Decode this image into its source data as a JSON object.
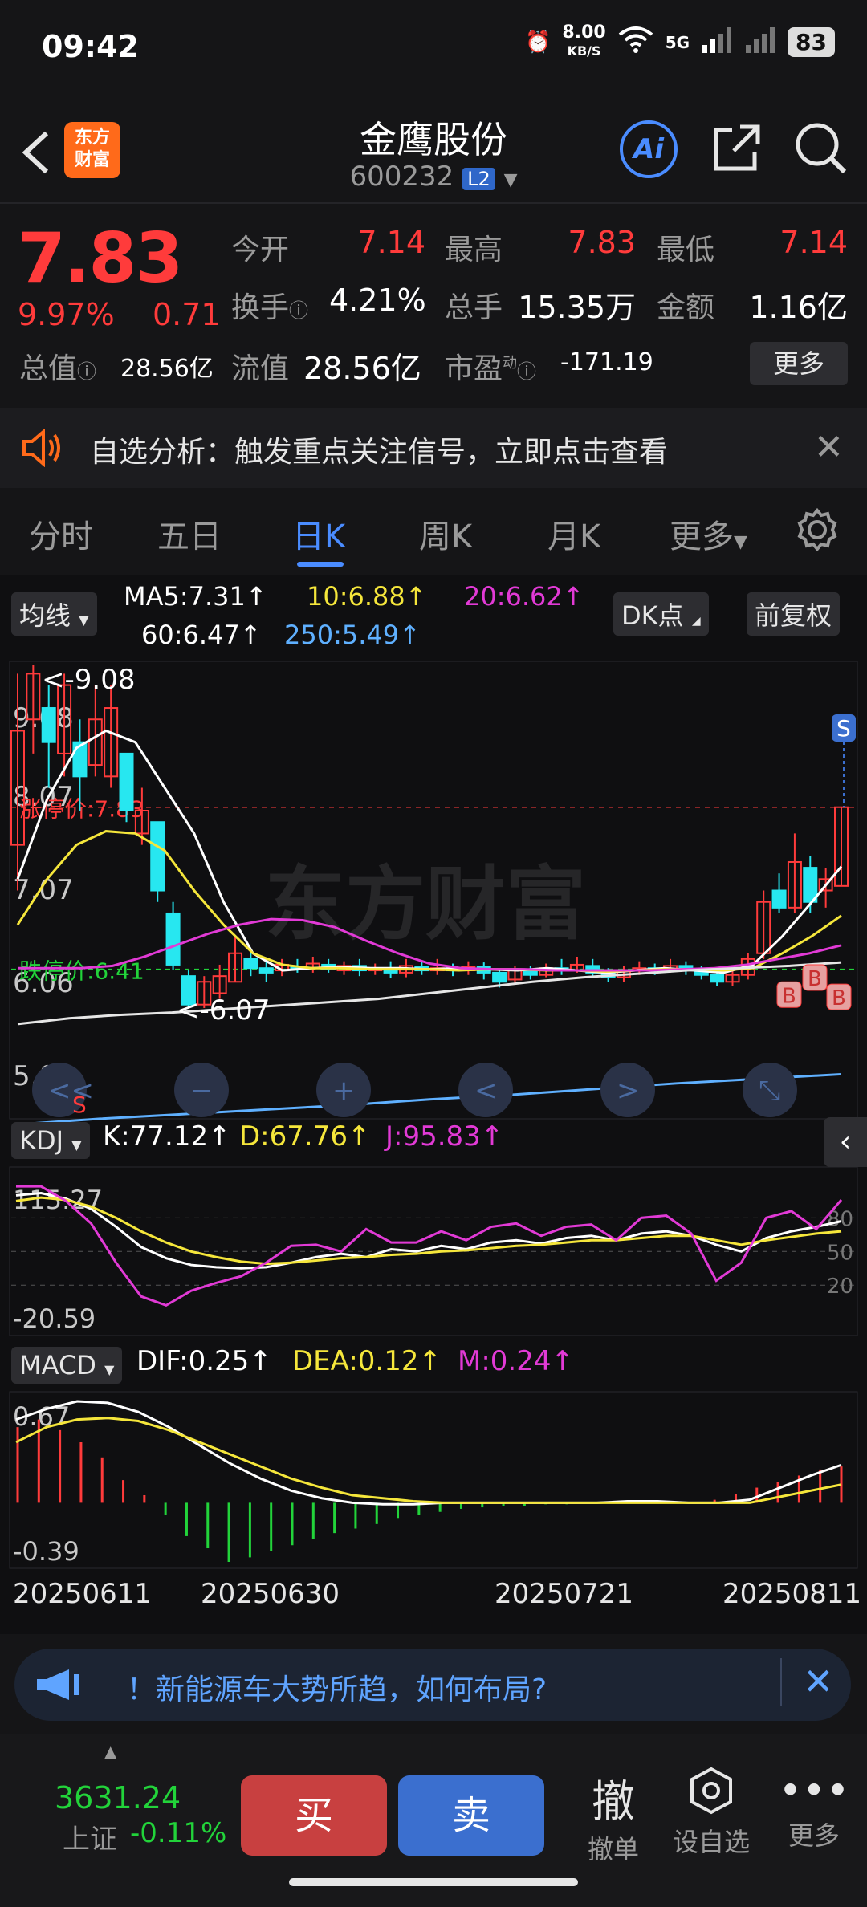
{
  "status_bar": {
    "time": "09:42",
    "net_speed_top": "8.00",
    "net_speed_unit": "KB/S",
    "signal": "5G",
    "battery": "83"
  },
  "header": {
    "logo_line1": "东方",
    "logo_line2": "财富",
    "stock_name": "金鹰股份",
    "stock_code": "600232",
    "level_badge": "L2"
  },
  "quote": {
    "price": "7.83",
    "change_pct": "9.97%",
    "change": "0.71",
    "open_label": "今开",
    "open": "7.14",
    "high_label": "最高",
    "high": "7.83",
    "low_label": "最低",
    "low": "7.14",
    "turnover_label": "换手",
    "turnover": "4.21%",
    "volume_label": "总手",
    "volume": "15.35万",
    "amount_label": "金额",
    "amount": "1.16亿",
    "mktcap_label": "总值",
    "mktcap": "28.56亿",
    "float_label": "流值",
    "float_cap": "28.56亿",
    "pe_label": "市盈",
    "pe_sup": "动",
    "pe": "-171.19",
    "more": "更多"
  },
  "notice": {
    "text": "自选分析：触发重点关注信号，立即点击查看"
  },
  "tabs": [
    {
      "label": "分时"
    },
    {
      "label": "五日"
    },
    {
      "label": "日K"
    },
    {
      "label": "周K"
    },
    {
      "label": "月K"
    },
    {
      "label": "更多"
    }
  ],
  "ma_bar": {
    "selector": "均线",
    "ma5": "MA5:7.31↑",
    "ma10": "10:6.88↑",
    "ma20": "20:6.62↑",
    "ma60": "60:6.47↑",
    "ma250": "250:5.49↑",
    "dk_btn": "DK点",
    "adjust_btn": "前复权"
  },
  "kline": {
    "y_labels": [
      "9.08",
      "8.07",
      "7.07",
      "6.06",
      "5.05"
    ],
    "high_annot": "<-9.08",
    "low_annot": "<-6.07",
    "limit_up": "涨停价:7.83",
    "limit_down": "跌停价:6.41",
    "watermark": "东方财富",
    "sell_marker": "S",
    "buy_marker": "B",
    "colors": {
      "up": "#ff3b3b",
      "down": "#27e7f0",
      "ma5": "#ffffff",
      "ma10": "#f5e63b",
      "ma20": "#e23ad6",
      "ma60": "#e6e6e6",
      "ma250": "#5fb0ff"
    }
  },
  "kdj": {
    "selector": "KDJ",
    "k": "K:77.12↑",
    "d": "D:67.76↑",
    "j": "J:95.83↑",
    "y_top": "115.27",
    "y_bottom": "-20.59",
    "levels": [
      "80",
      "50",
      "20"
    ]
  },
  "macd": {
    "selector": "MACD",
    "dif": "DIF:0.25↑",
    "dea": "DEA:0.12↑",
    "m": "M:0.24↑",
    "y_top": "0.67",
    "y_bottom": "-0.39"
  },
  "dates": [
    "20250611",
    "20250630",
    "20250721",
    "20250811"
  ],
  "ad": {
    "text": "！新能源车大势所趋，如何布局?"
  },
  "bottom": {
    "index_value": "3631.24",
    "index_name": "上证",
    "index_change": "-0.11%",
    "buy": "买",
    "sell": "卖",
    "cancel_icon": "撤",
    "cancel": "撤单",
    "watch": "设自选",
    "more": "更多"
  }
}
